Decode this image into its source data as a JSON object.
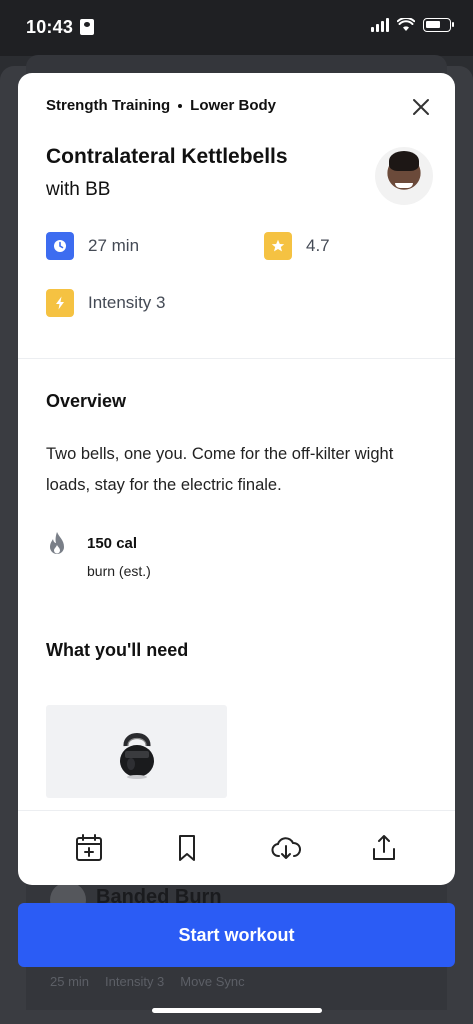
{
  "status_bar": {
    "time": "10:43"
  },
  "background_item": {
    "title": "Banded Burn",
    "meta": [
      "25 min",
      "Intensity 3",
      "Move Sync"
    ]
  },
  "modal": {
    "breadcrumb": {
      "category": "Strength Training",
      "focus": "Lower Body"
    },
    "title": "Contralateral Kettlebells",
    "subtitle": "with BB",
    "duration": "27 min",
    "rating": "4.7",
    "intensity": "Intensity 3",
    "overview": {
      "heading": "Overview",
      "text": "Two bells, one you. Come for the off-kilter wight loads, stay for the electric finale."
    },
    "calories": {
      "value": "150 cal",
      "label": "burn (est.)"
    },
    "equipment": {
      "heading": "What you'll need",
      "items": [
        "kettlebell"
      ]
    },
    "toolbar": [
      "calendar-add",
      "bookmark",
      "cloud-download",
      "share"
    ]
  },
  "start_button": {
    "label": "Start workout"
  },
  "colors": {
    "primary": "#2b5cf5",
    "duration_icon": "#3d6cf0",
    "rating_icon": "#f5c242",
    "intensity_icon": "#f5c242"
  }
}
